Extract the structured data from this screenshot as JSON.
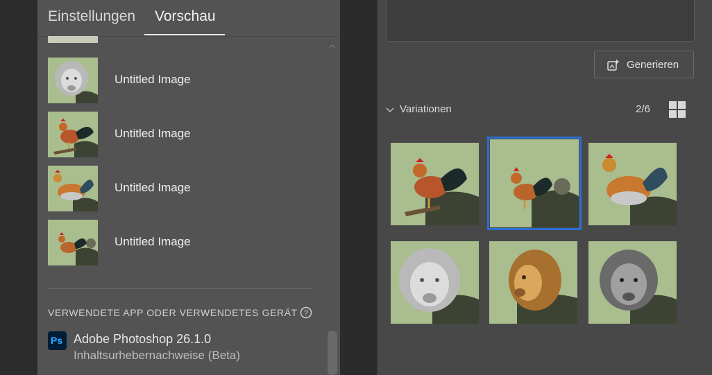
{
  "tabs": [
    {
      "label": "Einstellungen"
    },
    {
      "label": "Vorschau"
    }
  ],
  "history": [
    {
      "label": "Untitled Image",
      "thumb": "lion-sculpture"
    },
    {
      "label": "Untitled Image",
      "thumb": "rooster"
    },
    {
      "label": "Untitled Image",
      "thumb": "rooster"
    },
    {
      "label": "Untitled Image",
      "thumb": "rooster"
    }
  ],
  "app_section": {
    "title": "VERWENDETE APP ODER VERWENDETES GERÄT",
    "app_name": "Adobe Photoshop 26.1.0",
    "app_sub": "Inhaltsurhebernachweise (Beta)",
    "app_icon_text": "Ps"
  },
  "generate": {
    "label": "Generieren"
  },
  "variations": {
    "title": "Variationen",
    "count": "2/6",
    "items": [
      {
        "thumb": "rooster",
        "selected": false
      },
      {
        "thumb": "rooster",
        "selected": true
      },
      {
        "thumb": "rooster",
        "selected": false
      },
      {
        "thumb": "lion-sculpture",
        "selected": false
      },
      {
        "thumb": "lion",
        "selected": false
      },
      {
        "thumb": "lion-dark",
        "selected": false
      }
    ]
  },
  "colors": {
    "accent": "#2b6fd3",
    "thumb_bg": "#a9bd8e"
  }
}
